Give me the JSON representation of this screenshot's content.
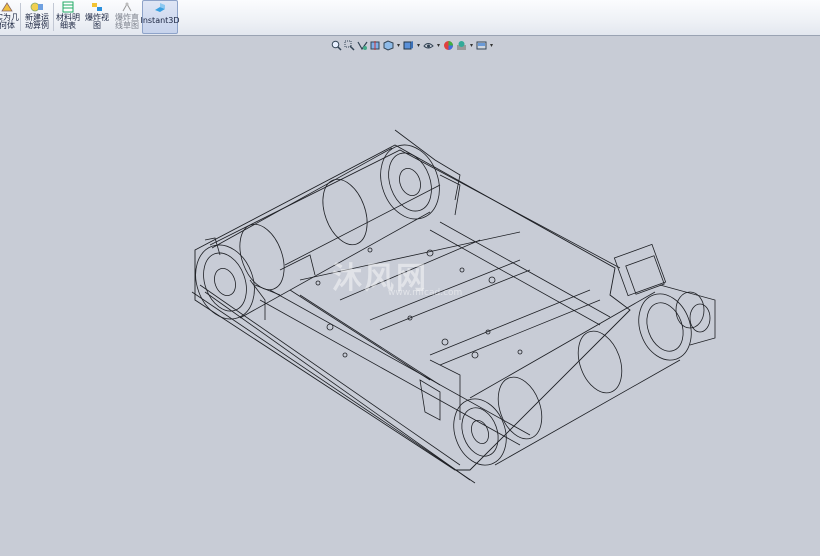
{
  "ribbon": {
    "buttons": [
      {
        "label": "实为几\n何体",
        "state": "partial"
      },
      {
        "label": "新建运\n动算例",
        "state": "normal"
      },
      {
        "label": "材料明\n细表",
        "state": "normal"
      },
      {
        "label": "爆炸视\n图",
        "state": "normal"
      },
      {
        "label": "爆炸直\n线草图",
        "state": "disabled"
      },
      {
        "label": "Instant3D",
        "state": "active"
      }
    ]
  },
  "view_toolbar": {
    "icons": [
      "zoom-to-fit-icon",
      "zoom-area-icon",
      "previous-view-icon",
      "section-view-icon",
      "view-orientation-icon",
      "display-style-icon",
      "hide-show-items-icon",
      "edit-appearance-icon",
      "apply-scene-icon",
      "view-settings-icon"
    ]
  },
  "watermark": {
    "brand": "沐风网",
    "url": "www.mfcad.com"
  },
  "colors": {
    "background": "#c8ccd6",
    "wireframe": "#1d1f24",
    "ribbon": "#eef1f6"
  }
}
